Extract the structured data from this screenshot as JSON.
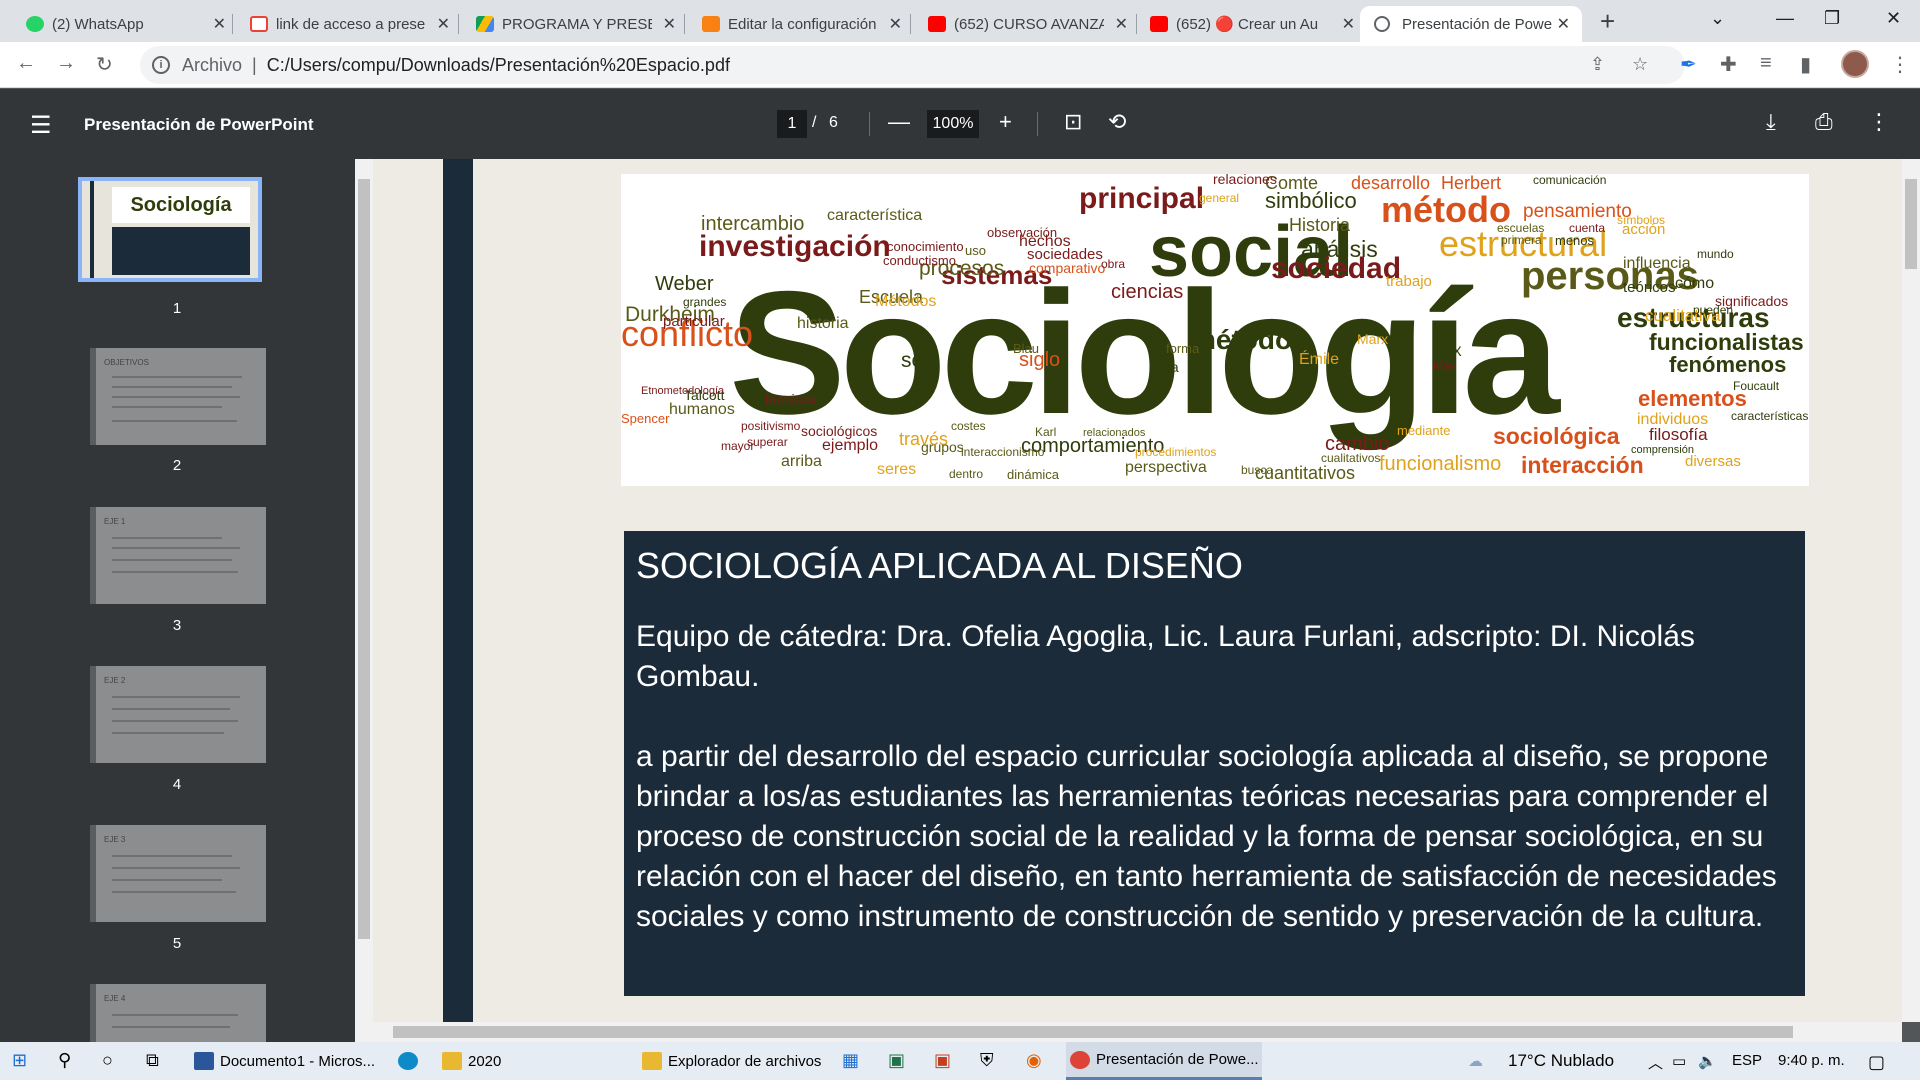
{
  "browser": {
    "tabs": [
      {
        "title": "(2) WhatsApp",
        "icon": "whatsapp-icon",
        "color": "#25d366"
      },
      {
        "title": "link de acceso a prese",
        "icon": "gmail-icon",
        "color": "#ea4335"
      },
      {
        "title": "PROGRAMA Y PRESEN",
        "icon": "google-drive-icon",
        "color": "#fbbc04"
      },
      {
        "title": "Editar la configuración",
        "icon": "moodle-icon",
        "color": "#f98012"
      },
      {
        "title": "(652) CURSO AVANZA",
        "icon": "youtube-icon",
        "color": "#ff0000"
      },
      {
        "title": "(652) 🔴 Crear un Au",
        "icon": "youtube-icon",
        "color": "#ff0000"
      },
      {
        "title": "Presentación de Powe",
        "icon": "globe-icon",
        "color": "#5f6368"
      }
    ],
    "address": {
      "scheme": "Archivo",
      "url": "C:/Users/compu/Downloads/Presentación%20Espacio.pdf"
    }
  },
  "pdf": {
    "title": "Presentación de PowerPoint",
    "current_page": "1",
    "page_sep": "/",
    "total_pages": "6",
    "zoom": "100%",
    "thumbnails": [
      {
        "num": "1",
        "heading": "Sociología"
      },
      {
        "num": "2",
        "heading": "OBJETIVOS"
      },
      {
        "num": "3",
        "heading": "EJE 1"
      },
      {
        "num": "4",
        "heading": "EJE 2"
      },
      {
        "num": "5",
        "heading": "EJE 3"
      },
      {
        "num": "6",
        "heading": "EJE 4"
      }
    ]
  },
  "slide": {
    "heading": "SOCIOLOGÍA APLICADA AL DISEÑO",
    "team": "Equipo de cátedra: Dra. Ofelia Agoglia, Lic. Laura Furlani, adscripto: DI. Nicolás Gombau.",
    "body": "a partir del desarrollo del espacio curricular sociología aplicada al diseño, se propone brindar a los/as estudiantes las herramientas teóricas necesarias para comprender el proceso de construcción social de la realidad y la forma de pensar sociológica, en su relación con el hacer del diseño, en tanto herramienta de satisfacción de necesidades sociales y como instrumento de construcción de sentido y preservación de la cultura.",
    "wordcloud": [
      {
        "w": "Sociología",
        "c": "#2f3d0c"
      },
      {
        "w": "social",
        "c": "#2f3d0c"
      },
      {
        "w": "sociedad",
        "c": "#7a1a1a"
      },
      {
        "w": "personas",
        "c": "#5a5a18"
      },
      {
        "w": "método",
        "c": "#d8501a"
      },
      {
        "w": "estructural",
        "c": "#e0a21a"
      },
      {
        "w": "principal",
        "c": "#7a1a1a"
      },
      {
        "w": "investigación",
        "c": "#7a1a1a"
      },
      {
        "w": "conflicto",
        "c": "#d8501a"
      },
      {
        "w": "sistemas",
        "c": "#7a1a1a"
      },
      {
        "w": "métodos",
        "c": "#2f3d0c"
      },
      {
        "w": "estructuras",
        "c": "#2f3d0c"
      },
      {
        "w": "funcionalistas",
        "c": "#2f3d0c"
      },
      {
        "w": "fenómenos",
        "c": "#2f3d0c"
      },
      {
        "w": "elementos",
        "c": "#d8501a"
      },
      {
        "w": "sociológica",
        "c": "#d8501a"
      },
      {
        "w": "interacción",
        "c": "#d8501a"
      },
      {
        "w": "funcionalismo",
        "c": "#e0a21a"
      },
      {
        "w": "Durkheim",
        "c": "#5a5a18"
      },
      {
        "w": "Weber",
        "c": "#2f3d0c"
      },
      {
        "w": "Comte",
        "c": "#5a5a18"
      },
      {
        "w": "Herbert",
        "c": "#d8501a"
      },
      {
        "w": "desarrollo",
        "c": "#d8501a"
      },
      {
        "w": "simbólico",
        "c": "#2f3d0c"
      },
      {
        "w": "relaciones",
        "c": "#7a1a1a"
      },
      {
        "w": "Historia",
        "c": "#5a5a18"
      },
      {
        "w": "análisis",
        "c": "#2f3d0c"
      },
      {
        "w": "intercambio",
        "c": "#5a5a18"
      },
      {
        "w": "característica",
        "c": "#5a5a18"
      },
      {
        "w": "procesos",
        "c": "#5a5a18"
      },
      {
        "w": "ciencias",
        "c": "#7a1a1a"
      },
      {
        "w": "Escuela",
        "c": "#5a5a18"
      },
      {
        "w": "pensamiento",
        "c": "#d8501a"
      },
      {
        "w": "cualitativa",
        "c": "#e0a21a"
      },
      {
        "w": "significados",
        "c": "#7a1a1a"
      },
      {
        "w": "influencia",
        "c": "#5a5a18"
      },
      {
        "w": "comportamiento",
        "c": "#2f3d0c"
      },
      {
        "w": "cambio",
        "c": "#7a1a1a"
      },
      {
        "w": "cuantitativos",
        "c": "#5a5a18"
      },
      {
        "w": "filosofía",
        "c": "#7a1a1a"
      },
      {
        "w": "individuos",
        "c": "#e0a21a"
      },
      {
        "w": "siglo",
        "c": "#d8501a"
      },
      {
        "w": "ser",
        "c": "#2f3d0c"
      },
      {
        "w": "vida",
        "c": "#2f3d0c"
      },
      {
        "w": "Émile",
        "c": "#e0a21a"
      },
      {
        "w": "historia",
        "c": "#5a5a18"
      },
      {
        "w": "particular",
        "c": "#7a1a1a"
      },
      {
        "w": "humanos",
        "c": "#5a5a18"
      },
      {
        "w": "través",
        "c": "#e0a21a"
      },
      {
        "w": "perspectiva",
        "c": "#5a5a18"
      },
      {
        "w": "diversas",
        "c": "#e0a21a"
      },
      {
        "w": "hechos",
        "c": "#7a1a1a"
      },
      {
        "w": "sociedades",
        "c": "#7a1a1a"
      },
      {
        "w": "comparativo",
        "c": "#d8501a"
      },
      {
        "w": "técnicas",
        "c": "#7a1a1a"
      },
      {
        "w": "ejemplo",
        "c": "#7a1a1a"
      },
      {
        "w": "arriba",
        "c": "#5a5a18"
      },
      {
        "w": "grupos",
        "c": "#5a5a18"
      },
      {
        "w": "Métodos",
        "c": "#e0a21a"
      },
      {
        "w": "Talcott",
        "c": "#2f3d0c"
      },
      {
        "w": "Spencer",
        "c": "#d8501a"
      },
      {
        "w": "sociológicos",
        "c": "#7a1a1a"
      },
      {
        "w": "seres",
        "c": "#e0a21a"
      },
      {
        "w": "trabajo",
        "c": "#e0a21a"
      },
      {
        "w": "cómo",
        "c": "#2f3d0c"
      },
      {
        "w": "teóricos",
        "c": "#2f3d0c"
      },
      {
        "w": "acción",
        "c": "#e0a21a"
      },
      {
        "w": "Foucault",
        "c": "#2f3d0c"
      },
      {
        "w": "Marx",
        "c": "#e0a21a"
      },
      {
        "w": "mediante",
        "c": "#e0a21a"
      },
      {
        "w": "comunicación",
        "c": "#2f3d0c"
      },
      {
        "w": "menos",
        "c": "#2f3d0c"
      },
      {
        "w": "mundo",
        "c": "#2f3d0c"
      },
      {
        "w": "pueden",
        "c": "#2f3d0c"
      },
      {
        "w": "símbolos",
        "c": "#e0a21a"
      },
      {
        "w": "Etnometodología",
        "c": "#7a1a1a"
      },
      {
        "w": "positivismo",
        "c": "#7a1a1a"
      },
      {
        "w": "superar",
        "c": "#7a1a1a"
      },
      {
        "w": "mayor",
        "c": "#7a1a1a"
      },
      {
        "w": "costes",
        "c": "#5a5a18"
      },
      {
        "w": "Karl",
        "c": "#5a5a18"
      },
      {
        "w": "relacionados",
        "c": "#5a5a18"
      },
      {
        "w": "interaccionismo",
        "c": "#5a5a18"
      },
      {
        "w": "procedimientos",
        "c": "#e0a21a"
      },
      {
        "w": "cualitativos",
        "c": "#5a5a18"
      },
      {
        "w": "comprensión",
        "c": "#2f3d0c"
      },
      {
        "w": "características",
        "c": "#2f3d0c"
      },
      {
        "w": "grandes",
        "c": "#2f3d0c"
      },
      {
        "w": "busca",
        "c": "#5a5a18"
      },
      {
        "w": "dentro",
        "c": "#5a5a18"
      },
      {
        "w": "dinámica",
        "c": "#5a5a18"
      },
      {
        "w": "observación",
        "c": "#7a1a1a"
      },
      {
        "w": "conocimiento",
        "c": "#7a1a1a"
      },
      {
        "w": "conductismo",
        "c": "#7a1a1a"
      },
      {
        "w": "uso",
        "c": "#5a5a18"
      },
      {
        "w": "obra",
        "c": "#7a1a1a"
      },
      {
        "w": "forma",
        "c": "#5a5a18"
      },
      {
        "w": "Blau",
        "c": "#5a5a18"
      },
      {
        "w": "XX",
        "c": "#2f3d0c"
      },
      {
        "w": "Max",
        "c": "#7a1a1a"
      },
      {
        "w": "general",
        "c": "#e0a21a"
      },
      {
        "w": "primera",
        "c": "#5a5a18"
      },
      {
        "w": "escuelas",
        "c": "#5a5a18"
      },
      {
        "w": "cuenta",
        "c": "#7a1a1a"
      }
    ]
  },
  "taskbar": {
    "apps": [
      {
        "label": "Documento1 - Micros...",
        "icon": "word-icon",
        "color": "#2b579a"
      },
      {
        "label": "",
        "icon": "edge-icon",
        "color": "#0f8ac9"
      },
      {
        "label": "2020",
        "icon": "folder-icon",
        "color": "#e8b830"
      },
      {
        "label": "Explorador de archivos",
        "icon": "folder-icon",
        "color": "#e8b830"
      },
      {
        "label": "Presentación de Powe...",
        "icon": "chrome-icon",
        "color": "#db4437"
      }
    ],
    "weather": "17°C  Nublado",
    "lang": "ESP",
    "time": "9:40 p. m."
  }
}
